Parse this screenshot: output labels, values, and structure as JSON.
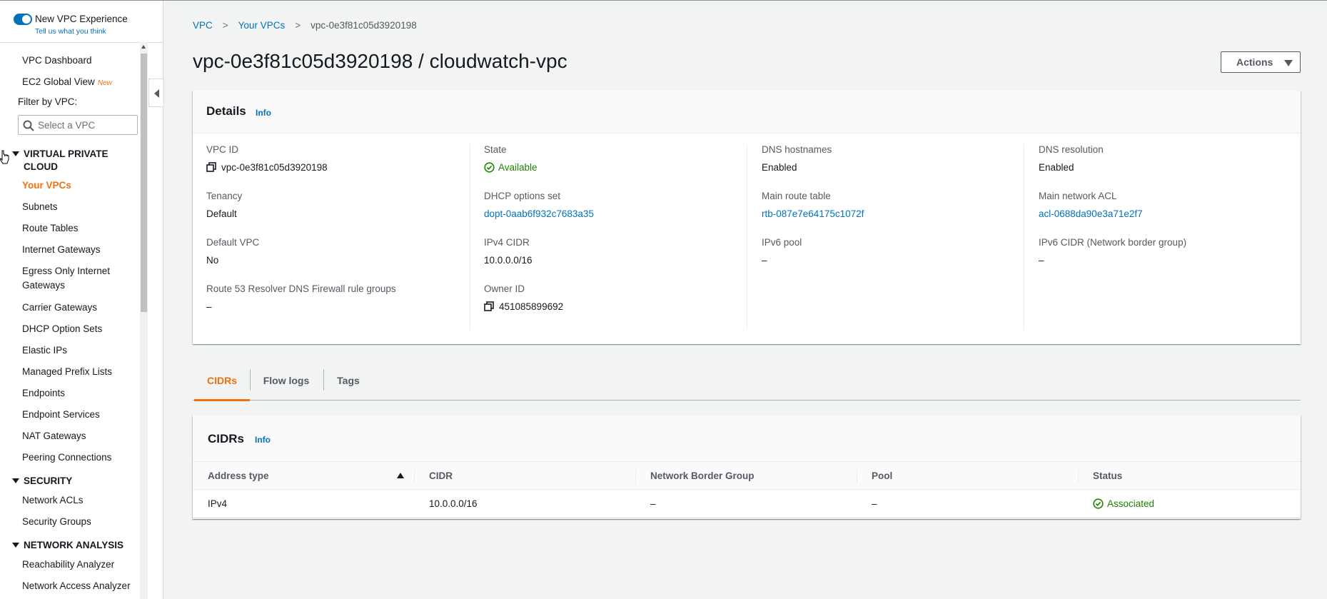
{
  "sidebar": {
    "experience_title": "New VPC Experience",
    "experience_feedback": "Tell us what you think",
    "dashboard": "VPC Dashboard",
    "global_view": "EC2 Global View",
    "new_badge": "New",
    "filter_label": "Filter by VPC:",
    "filter_placeholder": "Select a VPC",
    "vpc_section": {
      "title_line1": "VIRTUAL PRIVATE",
      "title_line2": "CLOUD",
      "items": [
        "Your VPCs",
        "Subnets",
        "Route Tables",
        "Internet Gateways",
        "Egress Only Internet",
        "Gateways",
        "Carrier Gateways",
        "DHCP Option Sets",
        "Elastic IPs",
        "Managed Prefix Lists",
        "Endpoints",
        "Endpoint Services",
        "NAT Gateways",
        "Peering Connections"
      ]
    },
    "security_section": {
      "title": "SECURITY",
      "items": [
        "Network ACLs",
        "Security Groups"
      ]
    },
    "analysis_section": {
      "title": "NETWORK ANALYSIS",
      "items": [
        "Reachability Analyzer",
        "Network Access Analyzer"
      ]
    }
  },
  "breadcrumb": {
    "root": "VPC",
    "parent": "Your VPCs",
    "current": "vpc-0e3f81c05d3920198"
  },
  "page_title": "vpc-0e3f81c05d3920198 / cloudwatch-vpc",
  "actions_label": "Actions",
  "details": {
    "title": "Details",
    "info": "Info",
    "fields": {
      "vpc_id_label": "VPC ID",
      "vpc_id": "vpc-0e3f81c05d3920198",
      "tenancy_label": "Tenancy",
      "tenancy": "Default",
      "default_vpc_label": "Default VPC",
      "default_vpc": "No",
      "r53_label": "Route 53 Resolver DNS Firewall rule groups",
      "r53": "–",
      "state_label": "State",
      "state": "Available",
      "dhcp_label": "DHCP options set",
      "dhcp": "dopt-0aab6f932c7683a35",
      "ipv4_label": "IPv4 CIDR",
      "ipv4": "10.0.0.0/16",
      "owner_label": "Owner ID",
      "owner": "451085899692",
      "dns_hostnames_label": "DNS hostnames",
      "dns_hostnames": "Enabled",
      "main_rt_label": "Main route table",
      "main_rt": "rtb-087e7e64175c1072f",
      "ipv6_pool_label": "IPv6 pool",
      "ipv6_pool": "–",
      "dns_resolution_label": "DNS resolution",
      "dns_resolution": "Enabled",
      "main_acl_label": "Main network ACL",
      "main_acl": "acl-0688da90e3a71e2f7",
      "ipv6_cidr_label": "IPv6 CIDR (Network border group)",
      "ipv6_cidr": "–"
    }
  },
  "tabs": [
    "CIDRs",
    "Flow logs",
    "Tags"
  ],
  "cidrs": {
    "title": "CIDRs",
    "info": "Info",
    "columns": [
      "Address type",
      "CIDR",
      "Network Border Group",
      "Pool",
      "Status"
    ],
    "rows": [
      [
        "IPv4",
        "10.0.0.0/16",
        "–",
        "–",
        "Associated"
      ]
    ]
  },
  "colors": {
    "accent_orange": "#ec7211",
    "link_blue": "#0073bb",
    "success_green": "#1d8102"
  }
}
